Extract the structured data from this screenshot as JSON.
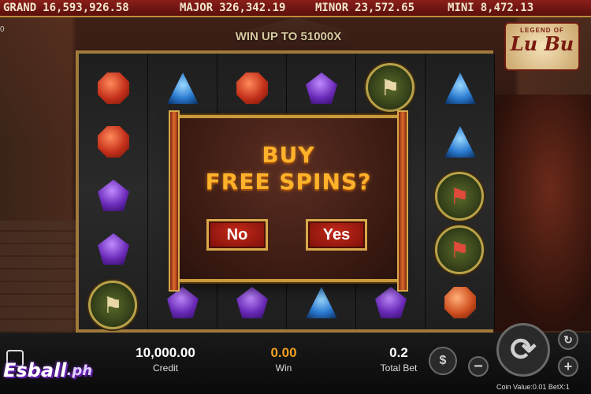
{
  "jackpots": {
    "grand_label": "GRAND",
    "grand_value": "16,593,926.58",
    "major_label": "MAJOR",
    "major_value": "326,342.19",
    "minor_label": "MINOR",
    "minor_value": "23,572.65",
    "mini_label": "MINI",
    "mini_value": "8,472.13"
  },
  "left_number": "0",
  "banner": "WIN UP TO 51000X",
  "logo": {
    "small": "LEGEND OF",
    "big": "Lu Bu"
  },
  "dialog": {
    "title_line1": "BUY",
    "title_line2": "FREE SPINS?",
    "no_label": "No",
    "yes_label": "Yes"
  },
  "stats": {
    "credit_value": "10,000.00",
    "credit_label": "Credit",
    "win_value": "0.00",
    "win_label": "Win",
    "bet_value": "0.2",
    "bet_label": "Total Bet"
  },
  "controls": {
    "coin_value": "Coin Value:0.01 BetX:1",
    "minus": "−",
    "plus": "+"
  },
  "branding": {
    "main": "Esball",
    "suffix": ".ph"
  },
  "colors": {
    "accent_gold": "#ffb22a",
    "win_orange": "#f0a020",
    "button_red": "#c42a1a"
  }
}
